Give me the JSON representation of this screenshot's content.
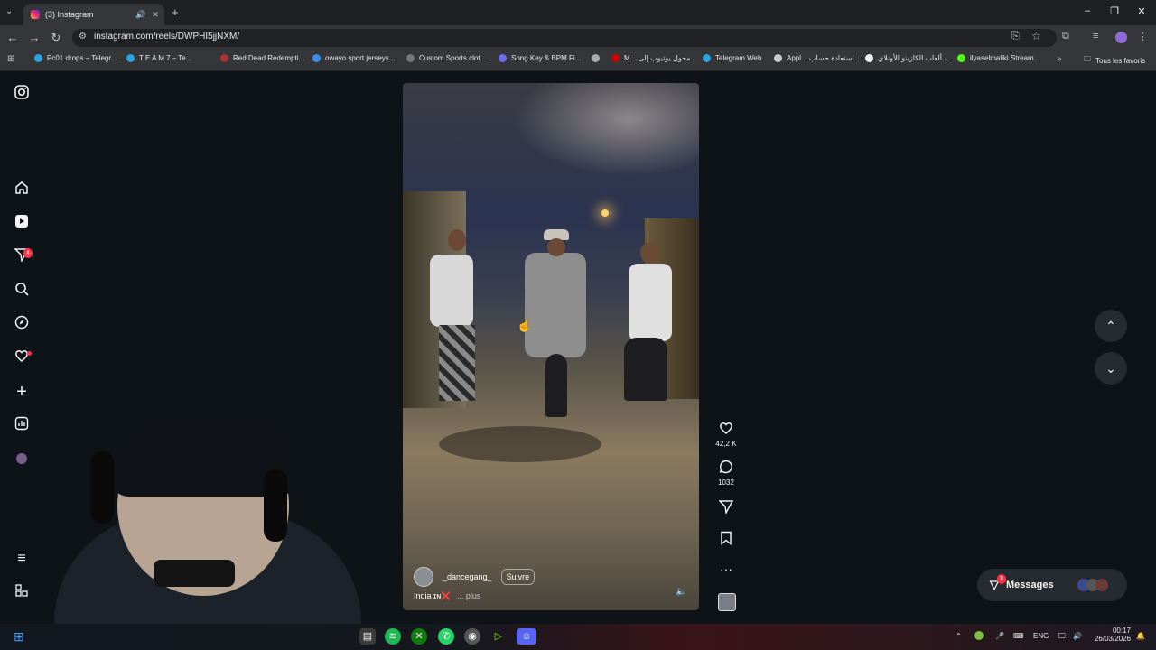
{
  "browser": {
    "tab_title": "(3) Instagram",
    "url": "instagram.com/reels/DWPHI5jjNXM/",
    "bookmarks": [
      "Pc01 drops – Telegr...",
      "T E A M 7 – Te...",
      "Red Dead Redempti...",
      "owayo sport jerseys...",
      "Custom Sports clot...",
      "Song Key & BPM Fi...",
      "M... محول يوتيوب إلى",
      "Telegram Web",
      "Appl... استعادة حساب",
      "ألعاب الكازينو الأونلاي...",
      "ilyaselmaliki Stream..."
    ],
    "all_bookmarks": "Tous les favoris"
  },
  "sidebar": {
    "notifications_badge": "4"
  },
  "reel": {
    "username": "_dancegang_",
    "follow_label": "Suivre",
    "caption": "India ɪɴ❌",
    "more_label": "... plus",
    "likes": "42,2 K",
    "comments": "1032"
  },
  "messages": {
    "label": "Messages",
    "badge": "3"
  },
  "taskbar": {
    "lang": "ENG",
    "time": "00:17",
    "date": "26/03/2026"
  },
  "colors": {
    "accent_badge": "#ff3040",
    "page_bg": "#0e1318"
  }
}
